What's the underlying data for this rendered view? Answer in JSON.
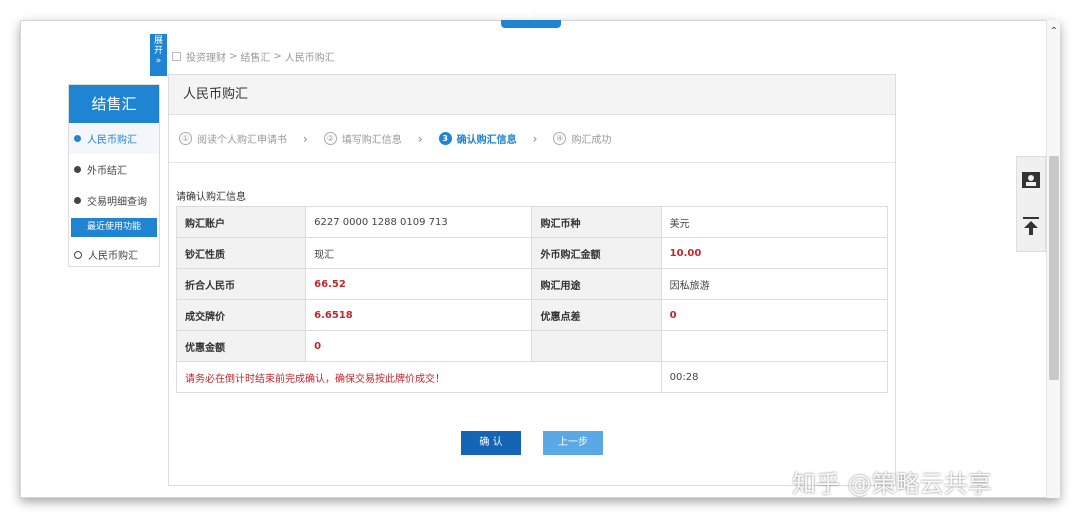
{
  "top_tab_icon": "chevron-up",
  "expand_tab": {
    "line1": "展",
    "line2": "开",
    "line3": "»"
  },
  "breadcrumb": {
    "items": [
      "投资理财",
      "结售汇",
      "人民币购汇"
    ],
    "sep": ">"
  },
  "sidebar": {
    "title": "结售汇",
    "items": [
      {
        "label": "人民币购汇",
        "active": true
      },
      {
        "label": "外币结汇",
        "active": false
      },
      {
        "label": "交易明细查询",
        "active": false
      }
    ],
    "recent_section": "最近使用功能",
    "recent_items": [
      {
        "label": "人民币购汇"
      }
    ]
  },
  "main": {
    "title": "人民币购汇",
    "steps": [
      {
        "num": "①",
        "label": "阅读个人购汇申请书"
      },
      {
        "num": "②",
        "label": "填写购汇信息"
      },
      {
        "num": "3",
        "label": "确认购汇信息",
        "current": true
      },
      {
        "num": "④",
        "label": "购汇成功"
      }
    ],
    "step_separator": "›",
    "section_label": "请确认购汇信息",
    "table": {
      "r1": {
        "l1": "购汇账户",
        "v1": "6227 0000 1288 0109 713",
        "l2": "购汇币种",
        "v2": "美元"
      },
      "r2": {
        "l1": "钞汇性质",
        "v1": "现汇",
        "l2": "外币购汇金额",
        "v2": "10.00"
      },
      "r3": {
        "l1": "折合人民币",
        "v1": "66.52",
        "l2": "购汇用途",
        "v2": "因私旅游"
      },
      "r4": {
        "l1": "成交牌价",
        "v1": "6.6518",
        "l2": "优惠点差",
        "v2": "0"
      },
      "r5": {
        "l1": "优惠金额",
        "v1": "0"
      },
      "notice": "请务必在倒计时结束前完成确认，确保交易按此牌价成交！",
      "countdown": "00:28"
    },
    "buttons": {
      "confirm": "确 认",
      "back": "上一步"
    }
  },
  "watermark": "知乎 @策略云共享",
  "colors": {
    "accent": "#1f84d2",
    "alert": "#c0272d"
  }
}
